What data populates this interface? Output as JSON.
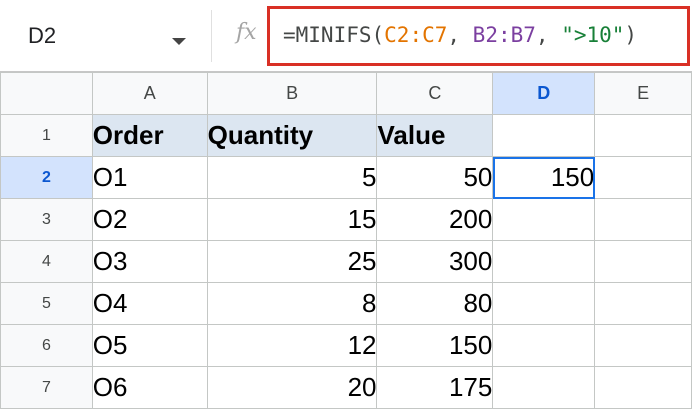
{
  "namebox": {
    "ref": "D2"
  },
  "formula_bar": {
    "fx_label": "fx",
    "parts": {
      "p1": "=MINIFS(",
      "p2": "C2:C7",
      "p3": ", ",
      "p4": "B2:B7",
      "p5": ", ",
      "p6": "\">10\"",
      "p7": ")"
    }
  },
  "columns": [
    "A",
    "B",
    "C",
    "D",
    "E"
  ],
  "rows": [
    "1",
    "2",
    "3",
    "4",
    "5",
    "6",
    "7"
  ],
  "headers": {
    "order": "Order",
    "quantity": "Quantity",
    "value": "Value"
  },
  "data": [
    {
      "order": "O1",
      "quantity": "5",
      "value": "50"
    },
    {
      "order": "O2",
      "quantity": "15",
      "value": "200"
    },
    {
      "order": "O3",
      "quantity": "25",
      "value": "300"
    },
    {
      "order": "O4",
      "quantity": "8",
      "value": "80"
    },
    {
      "order": "O5",
      "quantity": "12",
      "value": "150"
    },
    {
      "order": "O6",
      "quantity": "20",
      "value": "175"
    }
  ],
  "result": {
    "cell": "D2",
    "value": "150"
  },
  "colors": {
    "selection": "#1a73e8",
    "header_fill": "#dce6f1",
    "formula_highlight": "#d93025"
  }
}
